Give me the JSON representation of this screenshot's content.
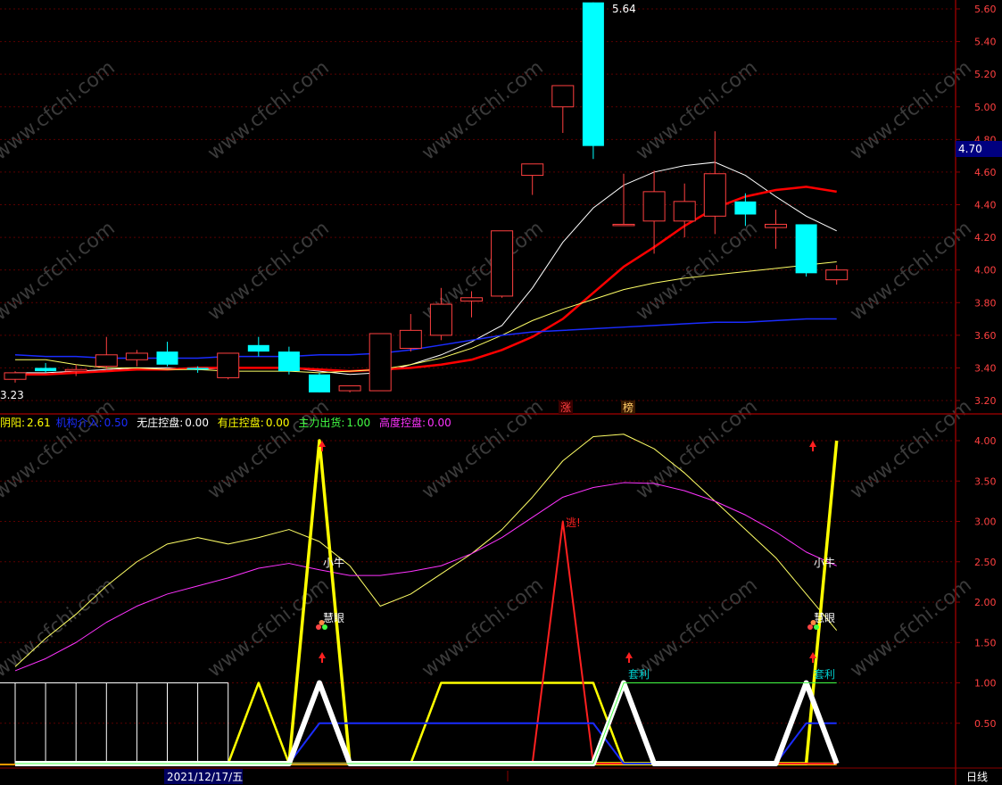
{
  "watermark": "www.cfchi.com",
  "colors": {
    "up": "#ff4040",
    "down": "#00ffff",
    "frame": "#8b0000",
    "grid": "#5a0000",
    "ma_white": "#ffffff",
    "ma_red": "#ff0000",
    "ma_yellow": "#ffff66",
    "ma_blue": "#1a2cff",
    "magenta": "#ff33ff",
    "indicator_yellow": "#ffff00",
    "indicator_green": "#44ff44",
    "indicator_orange": "#ff9900",
    "text_cyan": "#00cccc"
  },
  "price_panel": {
    "high_label": "5.64",
    "low_label": "3.23",
    "current_price_tag": "4.70",
    "markers": [
      "涨",
      "榜"
    ]
  },
  "indicator_panel": {
    "legend": [
      {
        "label": "阴阳:",
        "value": "2.61",
        "color": "#ffff00"
      },
      {
        "label": "机构介入:",
        "value": "0.50",
        "color": "#1a2cff"
      },
      {
        "label": "无庄控盘:",
        "value": "0.00",
        "color": "#ffffff"
      },
      {
        "label": "有庄控盘:",
        "value": "0.00",
        "color": "#ffff00"
      },
      {
        "label": "主力出货:",
        "value": "1.00",
        "color": "#44ff44"
      },
      {
        "label": "高度控盘:",
        "value": "0.00",
        "color": "#ff33ff"
      }
    ],
    "annotations": {
      "xiaoniu": "小牛",
      "huiyan": "慧眼",
      "tao": "逃!",
      "taoli": "套利"
    }
  },
  "footer": {
    "date_label": "2021/12/17/五",
    "period_label": "日线"
  },
  "chart_data": [
    {
      "type": "candlestick",
      "title": "",
      "yticks": [
        "3.20",
        "3.40",
        "3.60",
        "3.80",
        "4.00",
        "4.20",
        "4.40",
        "4.60",
        "4.80",
        "5.00",
        "5.20",
        "5.40",
        "5.60"
      ],
      "ylim": [
        3.15,
        5.66
      ],
      "candles": [
        {
          "o": 3.33,
          "h": 3.38,
          "l": 3.31,
          "c": 3.37
        },
        {
          "o": 3.4,
          "h": 3.43,
          "l": 3.37,
          "c": 3.38
        },
        {
          "o": 3.38,
          "h": 3.42,
          "l": 3.35,
          "c": 3.39
        },
        {
          "o": 3.41,
          "h": 3.59,
          "l": 3.39,
          "c": 3.48
        },
        {
          "o": 3.45,
          "h": 3.51,
          "l": 3.41,
          "c": 3.49
        },
        {
          "o": 3.5,
          "h": 3.56,
          "l": 3.41,
          "c": 3.42
        },
        {
          "o": 3.4,
          "h": 3.41,
          "l": 3.37,
          "c": 3.39
        },
        {
          "o": 3.34,
          "h": 3.49,
          "l": 3.33,
          "c": 3.49
        },
        {
          "o": 3.54,
          "h": 3.59,
          "l": 3.47,
          "c": 3.5
        },
        {
          "o": 3.5,
          "h": 3.53,
          "l": 3.36,
          "c": 3.38
        },
        {
          "o": 3.36,
          "h": 3.37,
          "l": 3.25,
          "c": 3.25
        },
        {
          "o": 3.26,
          "h": 3.29,
          "l": 3.25,
          "c": 3.29
        },
        {
          "o": 3.26,
          "h": 3.61,
          "l": 3.26,
          "c": 3.61
        },
        {
          "o": 3.52,
          "h": 3.73,
          "l": 3.5,
          "c": 3.63
        },
        {
          "o": 3.6,
          "h": 3.89,
          "l": 3.57,
          "c": 3.79
        },
        {
          "o": 3.81,
          "h": 3.87,
          "l": 3.71,
          "c": 3.83
        },
        {
          "o": 3.84,
          "h": 4.24,
          "l": 3.83,
          "c": 4.24
        },
        {
          "o": 4.58,
          "h": 4.65,
          "l": 4.46,
          "c": 4.65
        },
        {
          "o": 5.0,
          "h": 5.13,
          "l": 4.84,
          "c": 5.13
        },
        {
          "o": 5.64,
          "h": 5.64,
          "l": 4.68,
          "c": 4.76
        },
        {
          "o": 4.28,
          "h": 4.59,
          "l": 4.27,
          "c": 4.28
        },
        {
          "o": 4.3,
          "h": 4.61,
          "l": 4.1,
          "c": 4.48
        },
        {
          "o": 4.3,
          "h": 4.53,
          "l": 4.2,
          "c": 4.42
        },
        {
          "o": 4.33,
          "h": 4.85,
          "l": 4.22,
          "c": 4.59
        },
        {
          "o": 4.42,
          "h": 4.47,
          "l": 4.27,
          "c": 4.34
        },
        {
          "o": 4.26,
          "h": 4.37,
          "l": 4.13,
          "c": 4.28
        },
        {
          "o": 4.28,
          "h": 4.28,
          "l": 3.96,
          "c": 3.98
        },
        {
          "o": 3.94,
          "h": 4.03,
          "l": 3.91,
          "c": 4.0
        }
      ],
      "series": [
        {
          "color": "#ffffff",
          "values": [
            3.37,
            3.37,
            3.38,
            3.39,
            3.4,
            3.4,
            3.39,
            3.4,
            3.4,
            3.4,
            3.38,
            3.36,
            3.37,
            3.42,
            3.48,
            3.56,
            3.66,
            3.89,
            4.17,
            4.38,
            4.52,
            4.6,
            4.64,
            4.66,
            4.58,
            4.45,
            4.33,
            4.24
          ]
        },
        {
          "color": "#ff0000",
          "values": [
            3.36,
            3.36,
            3.37,
            3.38,
            3.39,
            3.39,
            3.4,
            3.4,
            3.4,
            3.4,
            3.39,
            3.38,
            3.39,
            3.4,
            3.42,
            3.45,
            3.51,
            3.59,
            3.7,
            3.86,
            4.02,
            4.14,
            4.27,
            4.38,
            4.45,
            4.49,
            4.51,
            4.48
          ]
        },
        {
          "color": "#ffff66",
          "values": [
            3.45,
            3.45,
            3.42,
            3.4,
            3.4,
            3.39,
            3.39,
            3.38,
            3.38,
            3.38,
            3.37,
            3.38,
            3.39,
            3.42,
            3.46,
            3.52,
            3.6,
            3.69,
            3.76,
            3.82,
            3.88,
            3.92,
            3.95,
            3.97,
            3.99,
            4.01,
            4.03,
            4.05
          ]
        },
        {
          "color": "#1a2cff",
          "values": [
            3.48,
            3.47,
            3.47,
            3.46,
            3.46,
            3.46,
            3.46,
            3.47,
            3.47,
            3.47,
            3.48,
            3.48,
            3.49,
            3.51,
            3.54,
            3.57,
            3.6,
            3.62,
            3.63,
            3.64,
            3.65,
            3.66,
            3.67,
            3.68,
            3.68,
            3.69,
            3.7,
            3.7
          ]
        }
      ]
    },
    {
      "type": "line",
      "title": "",
      "yticks": [
        "0.50",
        "1.00",
        "1.50",
        "2.00",
        "2.50",
        "3.00",
        "3.50",
        "4.00"
      ],
      "ylim": [
        0.0,
        4.2
      ],
      "series": [
        {
          "name": "阴阳",
          "color": "#ffff66",
          "values": [
            1.2,
            1.55,
            1.85,
            2.2,
            2.5,
            2.72,
            2.8,
            2.72,
            2.8,
            2.9,
            2.75,
            2.45,
            1.95,
            2.1,
            2.35,
            2.6,
            2.9,
            3.3,
            3.75,
            4.05,
            4.08,
            3.9,
            3.6,
            3.25,
            2.9,
            2.55,
            2.1,
            1.65
          ]
        },
        {
          "name": "高度控盘",
          "color": "#ff33ff",
          "values": [
            1.15,
            1.3,
            1.5,
            1.75,
            1.95,
            2.1,
            2.2,
            2.3,
            2.42,
            2.48,
            2.4,
            2.33,
            2.33,
            2.38,
            2.45,
            2.6,
            2.8,
            3.05,
            3.3,
            3.42,
            3.48,
            3.47,
            3.38,
            3.25,
            3.08,
            2.87,
            2.62,
            2.45
          ]
        },
        {
          "name": "小牛",
          "color": "#ffff00",
          "width": 3.5,
          "values": [
            0,
            0,
            0,
            0,
            0,
            0,
            0,
            0,
            0,
            0,
            4.0,
            0,
            0,
            0,
            0,
            0,
            0,
            0,
            0,
            0,
            0,
            0,
            0,
            0,
            0,
            0,
            0,
            4.0
          ]
        },
        {
          "name": "阴阳信号",
          "color": "#ffff00",
          "width": 2.5,
          "values": [
            0,
            0,
            0,
            0,
            0,
            0,
            0,
            0,
            1.0,
            0,
            0,
            0,
            0,
            0,
            1.0,
            1.0,
            1.0,
            1.0,
            1.0,
            1.0,
            0,
            0,
            0,
            0,
            0,
            0,
            0,
            0
          ]
        },
        {
          "name": "逃",
          "color": "#ff2020",
          "width": 2,
          "values": [
            0,
            0,
            0,
            0,
            0,
            0,
            0,
            0,
            0,
            0,
            0,
            0,
            0,
            0,
            0,
            0,
            0,
            0,
            3.0,
            0,
            0,
            0,
            0,
            0,
            0,
            0,
            0,
            0
          ]
        },
        {
          "name": "机构介入",
          "color": "#1a2cff",
          "width": 2,
          "values": [
            0,
            0,
            0,
            0,
            0,
            0,
            0,
            0,
            0,
            0,
            0.5,
            0.5,
            0.5,
            0.5,
            0.5,
            0.5,
            0.5,
            0.5,
            0.5,
            0.5,
            0,
            0,
            0,
            0,
            0,
            0,
            0.5,
            0.5
          ]
        },
        {
          "name": "主力出货",
          "color": "#ffffff",
          "width": 6,
          "values": [
            0,
            0,
            0,
            0,
            0,
            0,
            0,
            0,
            0,
            0,
            1.0,
            0,
            0,
            0,
            0,
            0,
            0,
            0,
            0,
            0,
            1.0,
            0,
            0,
            0,
            0,
            0,
            1.0,
            0
          ]
        },
        {
          "name": "套利",
          "color": "#44ff44",
          "width": 1,
          "values": [
            0,
            0,
            0,
            0,
            0,
            0,
            0,
            0,
            0,
            0,
            0,
            0,
            0,
            0,
            0,
            0,
            0,
            0,
            0,
            0,
            1.0,
            1.0,
            1.0,
            1.0,
            1.0,
            1.0,
            1.0,
            1.0
          ]
        }
      ]
    }
  ]
}
